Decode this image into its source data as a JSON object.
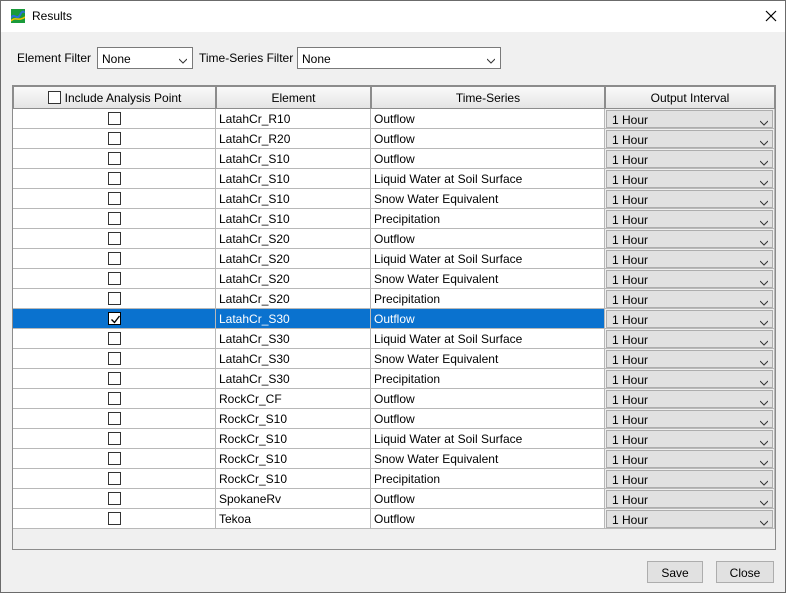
{
  "window": {
    "title": "Results",
    "app_icon": "results-app-icon",
    "close_icon": "close-icon"
  },
  "filters": {
    "element_filter_label": "Element Filter",
    "element_filter_value": "None",
    "time_series_filter_label": "Time-Series Filter",
    "time_series_filter_value": "None"
  },
  "table": {
    "columns": [
      "Include Analysis Point",
      "Element",
      "Time-Series",
      "Output Interval"
    ],
    "rows": [
      {
        "checked": false,
        "element": "LatahCr_R10",
        "series": "Outflow",
        "interval": "1 Hour",
        "selected": false
      },
      {
        "checked": false,
        "element": "LatahCr_R20",
        "series": "Outflow",
        "interval": "1 Hour",
        "selected": false
      },
      {
        "checked": false,
        "element": "LatahCr_S10",
        "series": "Outflow",
        "interval": "1 Hour",
        "selected": false
      },
      {
        "checked": false,
        "element": "LatahCr_S10",
        "series": "Liquid Water at Soil Surface",
        "interval": "1 Hour",
        "selected": false
      },
      {
        "checked": false,
        "element": "LatahCr_S10",
        "series": "Snow Water Equivalent",
        "interval": "1 Hour",
        "selected": false
      },
      {
        "checked": false,
        "element": "LatahCr_S10",
        "series": "Precipitation",
        "interval": "1 Hour",
        "selected": false
      },
      {
        "checked": false,
        "element": "LatahCr_S20",
        "series": "Outflow",
        "interval": "1 Hour",
        "selected": false
      },
      {
        "checked": false,
        "element": "LatahCr_S20",
        "series": "Liquid Water at Soil Surface",
        "interval": "1 Hour",
        "selected": false
      },
      {
        "checked": false,
        "element": "LatahCr_S20",
        "series": "Snow Water Equivalent",
        "interval": "1 Hour",
        "selected": false
      },
      {
        "checked": false,
        "element": "LatahCr_S20",
        "series": "Precipitation",
        "interval": "1 Hour",
        "selected": false
      },
      {
        "checked": true,
        "element": "LatahCr_S30",
        "series": "Outflow",
        "interval": "1 Hour",
        "selected": true
      },
      {
        "checked": false,
        "element": "LatahCr_S30",
        "series": "Liquid Water at Soil Surface",
        "interval": "1 Hour",
        "selected": false
      },
      {
        "checked": false,
        "element": "LatahCr_S30",
        "series": "Snow Water Equivalent",
        "interval": "1 Hour",
        "selected": false
      },
      {
        "checked": false,
        "element": "LatahCr_S30",
        "series": "Precipitation",
        "interval": "1 Hour",
        "selected": false
      },
      {
        "checked": false,
        "element": "RockCr_CF",
        "series": "Outflow",
        "interval": "1 Hour",
        "selected": false
      },
      {
        "checked": false,
        "element": "RockCr_S10",
        "series": "Outflow",
        "interval": "1 Hour",
        "selected": false
      },
      {
        "checked": false,
        "element": "RockCr_S10",
        "series": "Liquid Water at Soil Surface",
        "interval": "1 Hour",
        "selected": false
      },
      {
        "checked": false,
        "element": "RockCr_S10",
        "series": "Snow Water Equivalent",
        "interval": "1 Hour",
        "selected": false
      },
      {
        "checked": false,
        "element": "RockCr_S10",
        "series": "Precipitation",
        "interval": "1 Hour",
        "selected": false
      },
      {
        "checked": false,
        "element": "SpokaneRv",
        "series": "Outflow",
        "interval": "1 Hour",
        "selected": false
      },
      {
        "checked": false,
        "element": "Tekoa",
        "series": "Outflow",
        "interval": "1 Hour",
        "selected": false
      }
    ]
  },
  "buttons": {
    "save_label": "Save",
    "close_label": "Close"
  },
  "colors": {
    "selection": "#0a72cf",
    "window_bg": "#f0f0f0"
  }
}
